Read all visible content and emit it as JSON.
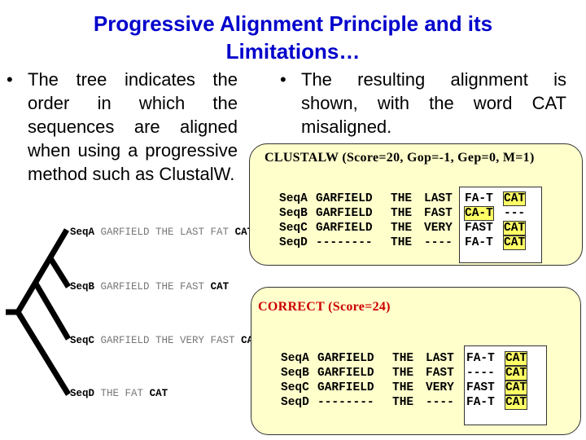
{
  "title": {
    "line1": "Progressive Alignment Principle and its",
    "line2": "Limitations…"
  },
  "bullets": {
    "left": "The tree indicates the order in which the sequences are aligned when using a progressive method such as ClustalW.",
    "right": "The resulting alignment is shown, with the word CAT misaligned.",
    "marker": "•"
  },
  "tree": {
    "sequences": [
      {
        "name": "SeqA",
        "text": "GARFIELD THE LAST FAT",
        "last": "CAT"
      },
      {
        "name": "SeqB",
        "text": "GARFIELD THE FAST",
        "last": "CAT"
      },
      {
        "name": "SeqC",
        "text": "GARFIELD THE VERY FAST",
        "last": "CAT"
      },
      {
        "name": "SeqD",
        "text": "THE FAT",
        "last": "CAT"
      }
    ]
  },
  "clustalw": {
    "header": "CLUSTALW (Score=20, Gop=-1, Gep=0, M=1)",
    "rows": [
      {
        "name": "SeqA",
        "w1": "GARFIELD",
        "w2": "THE",
        "w3": "LAST",
        "w4": "FA-T",
        "w5": "CAT",
        "hl4": false,
        "hl5": true
      },
      {
        "name": "SeqB",
        "w1": "GARFIELD",
        "w2": "THE",
        "w3": "FAST",
        "w4": "CA-T",
        "w5": "---",
        "hl4": true,
        "hl5": false
      },
      {
        "name": "SeqC",
        "w1": "GARFIELD",
        "w2": "THE",
        "w3": "VERY",
        "w4": "FAST",
        "w5": "CAT",
        "hl4": false,
        "hl5": true
      },
      {
        "name": "SeqD",
        "w1": "--------",
        "w2": "THE",
        "w3": "----",
        "w4": "FA-T",
        "w5": "CAT",
        "hl4": false,
        "hl5": true
      }
    ]
  },
  "correct": {
    "header": "CORRECT (Score=24)",
    "rows": [
      {
        "name": "SeqA",
        "w1": "GARFIELD",
        "w2": "THE",
        "w3": "LAST",
        "w4": "FA-T",
        "w5": "CAT",
        "hl4": false,
        "hl5": true
      },
      {
        "name": "SeqB",
        "w1": "GARFIELD",
        "w2": "THE",
        "w3": "FAST",
        "w4": "----",
        "w5": "CAT",
        "hl4": false,
        "hl5": true
      },
      {
        "name": "SeqC",
        "w1": "GARFIELD",
        "w2": "THE",
        "w3": "VERY",
        "w4": "FAST",
        "w5": "CAT",
        "hl4": false,
        "hl5": true
      },
      {
        "name": "SeqD",
        "w1": "--------",
        "w2": "THE",
        "w3": "----",
        "w4": "FA-T",
        "w5": "CAT",
        "hl4": false,
        "hl5": true
      }
    ]
  },
  "colors": {
    "title": "#0000cc",
    "box_fill": "#ffffcc",
    "highlight": "#ffff66",
    "correct_header": "#cc0000"
  }
}
